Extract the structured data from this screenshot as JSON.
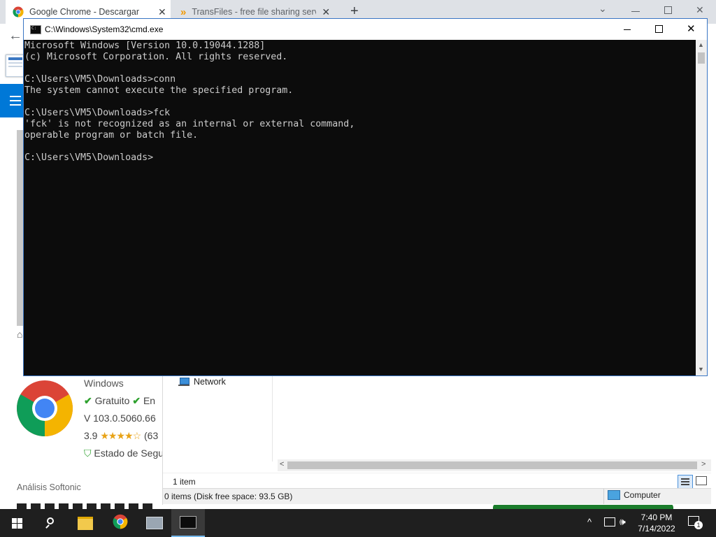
{
  "browser": {
    "tabs": [
      {
        "title": "Google Chrome - Descargar"
      },
      {
        "title": "TransFiles - free file sharing servi"
      }
    ],
    "new_tab_label": "+"
  },
  "softonic": {
    "platform": "Windows",
    "free_label": "Gratuito",
    "lang_label": "En",
    "version": "V 103.0.5060.66",
    "rating": "3.9",
    "rating_count": "(63",
    "security_label": "Estado de Segu",
    "analysis_label": "Análisis Softonic",
    "rating_value": 3.9,
    "rating_max": 5
  },
  "explorer": {
    "nav_item": "Network",
    "item_count": "1 item",
    "disk_status": "0 items (Disk free space: 93.5 GB)",
    "location": "Computer"
  },
  "cmd": {
    "title": "C:\\Windows\\System32\\cmd.exe",
    "output": "Microsoft Windows [Version 10.0.19044.1288]\n(c) Microsoft Corporation. All rights reserved.\n\nC:\\Users\\VM5\\Downloads>conn\nThe system cannot execute the specified program.\n\nC:\\Users\\VM5\\Downloads>fck\n'fck' is not recognized as an internal or external command,\noperable program or batch file.\n\nC:\\Users\\VM5\\Downloads>"
  },
  "taskbar": {
    "time": "7:40 PM",
    "date": "7/14/2022",
    "notification_count": "1"
  },
  "colors": {
    "cmd_background": "#0c0c0c",
    "cmd_text": "#cccccc",
    "taskbar": "#1f1f1f",
    "softonic_blue": "#0078d7",
    "check_green": "#2ea12e",
    "star_gold": "#e8a317"
  }
}
